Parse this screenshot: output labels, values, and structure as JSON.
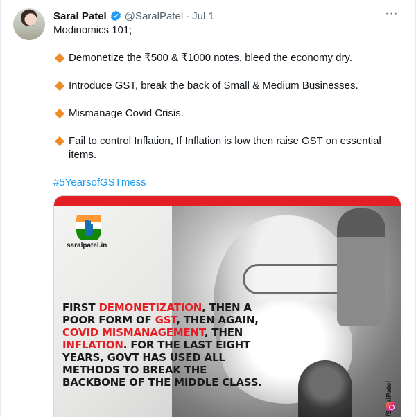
{
  "tweet": {
    "author_name": "Saral Patel",
    "handle": "@SaralPatel",
    "separator": "·",
    "date": "Jul 1",
    "more_label": "···",
    "intro": "Modinomics 101;",
    "bullets": [
      "Demonetize the ₹500 & ₹1000 notes, bleed the economy dry.",
      "Introduce GST, break the back of Small & Medium Businesses.",
      "Mismanage Covid Crisis.",
      "Fail to control Inflation, If Inflation is low then raise GST on essential items."
    ],
    "hashtag": "#5YearsofGSTmess"
  },
  "media": {
    "brand_name": "saralpatel.in",
    "headline_parts": [
      {
        "text": "FIRST ",
        "highlight": false
      },
      {
        "text": "DEMONETIZATION",
        "highlight": true
      },
      {
        "text": ", THEN A POOR FORM OF ",
        "highlight": false
      },
      {
        "text": "GST",
        "highlight": true
      },
      {
        "text": ", THEN AGAIN, ",
        "highlight": false
      },
      {
        "text": "COVID MISMANAGEMENT",
        "highlight": true
      },
      {
        "text": ", THEN ",
        "highlight": false
      },
      {
        "text": "INFLATION",
        "highlight": true
      },
      {
        "text": ". FOR THE LAST EIGHT YEARS, GOVT HAS USED ALL METHODS TO BREAK THE BACKBONE OF THE MIDDLE CLASS.",
        "highlight": false
      }
    ],
    "vertical_handle": "/SaralPatel"
  },
  "colors": {
    "accent_red": "#e31e24",
    "bullet_orange": "#f08a24",
    "link_blue": "#1d9bf0",
    "verified_blue": "#1d9bf0",
    "muted_text": "#536471"
  },
  "icons": {
    "verified": "verified-badge-icon",
    "more": "more-options-icon",
    "bullet": "orange-diamond-icon",
    "instagram": "instagram-icon",
    "party_logo": "hand-logo-icon"
  }
}
